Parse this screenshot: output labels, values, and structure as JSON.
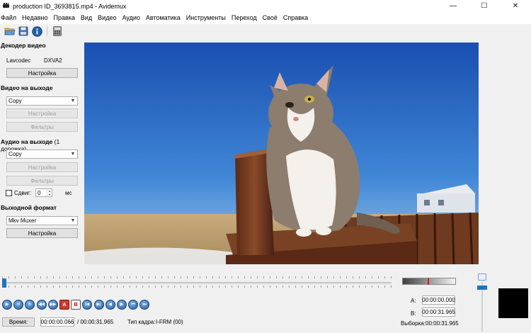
{
  "window": {
    "title": "production ID_3693815.mp4 - Avidemux",
    "minimize": "—",
    "maximize": "☐",
    "close": "✕"
  },
  "menu": [
    "Файл",
    "Недавно",
    "Правка",
    "Вид",
    "Видео",
    "Аудио",
    "Автоматика",
    "Инструменты",
    "Переход",
    "Своё",
    "Справка"
  ],
  "toolbar": {
    "icons": [
      "open-folder-icon",
      "save-disk-icon",
      "info-icon",
      "calculator-icon"
    ]
  },
  "video_decoder": {
    "title": "Декодер видео",
    "decoder": "Lavcodec",
    "mode": "DXVA2",
    "settings": "Настройка"
  },
  "video_output": {
    "title": "Видео на выходе",
    "codec": "Copy",
    "settings": "Настройка",
    "filters": "Фильтры"
  },
  "audio_output": {
    "title": "Аудио на выходе",
    "tracks": "(1 дорожка)",
    "codec": "Copy",
    "settings": "Настройка",
    "filters": "Фильтры",
    "shift_label": "Сдвиг:",
    "shift_value": "0",
    "shift_unit": "мс",
    "shift_checked": false
  },
  "output_format": {
    "title": "Выходной формат",
    "muxer": "Mkv Muxer",
    "settings": "Настройка"
  },
  "timeline": {
    "position_fraction": 0.002
  },
  "playback_controls": [
    {
      "name": "play-button",
      "glyph": "▶",
      "style": "round"
    },
    {
      "name": "rewind-button",
      "glyph": "↺",
      "style": "round"
    },
    {
      "name": "forward-button",
      "glyph": "↻",
      "style": "round"
    },
    {
      "name": "prev-keyframe-button",
      "glyph": "◀◀",
      "style": "round"
    },
    {
      "name": "next-keyframe-button",
      "glyph": "▶▶",
      "style": "round"
    },
    {
      "name": "set-marker-a-button",
      "glyph": "A",
      "style": "red"
    },
    {
      "name": "set-marker-b-button",
      "glyph": "B",
      "style": "square"
    },
    {
      "name": "goto-marker-a-button",
      "glyph": "|◀",
      "style": "round"
    },
    {
      "name": "goto-marker-b-button",
      "glyph": "▶|",
      "style": "round"
    },
    {
      "name": "prev-black-frame-button",
      "glyph": "◀",
      "style": "round"
    },
    {
      "name": "next-black-frame-button",
      "glyph": "▶",
      "style": "round"
    },
    {
      "name": "goto-start-button",
      "glyph": "⏮",
      "style": "round"
    },
    {
      "name": "goto-end-button",
      "glyph": "⏭",
      "style": "round"
    }
  ],
  "status": {
    "time_button": "Время:",
    "current_time": "00:00:00.066",
    "total_time": "/ 00:00:31.965",
    "frame_type_label": "Тип кадра:",
    "frame_type": "I-FRM (00)"
  },
  "markers": {
    "a_label": "A:",
    "a_value": "00:00:00.000",
    "b_label": "B:",
    "b_value": "00:00:31.965",
    "selection_label": "Выборка:",
    "selection_value": "00:00:31.965"
  }
}
